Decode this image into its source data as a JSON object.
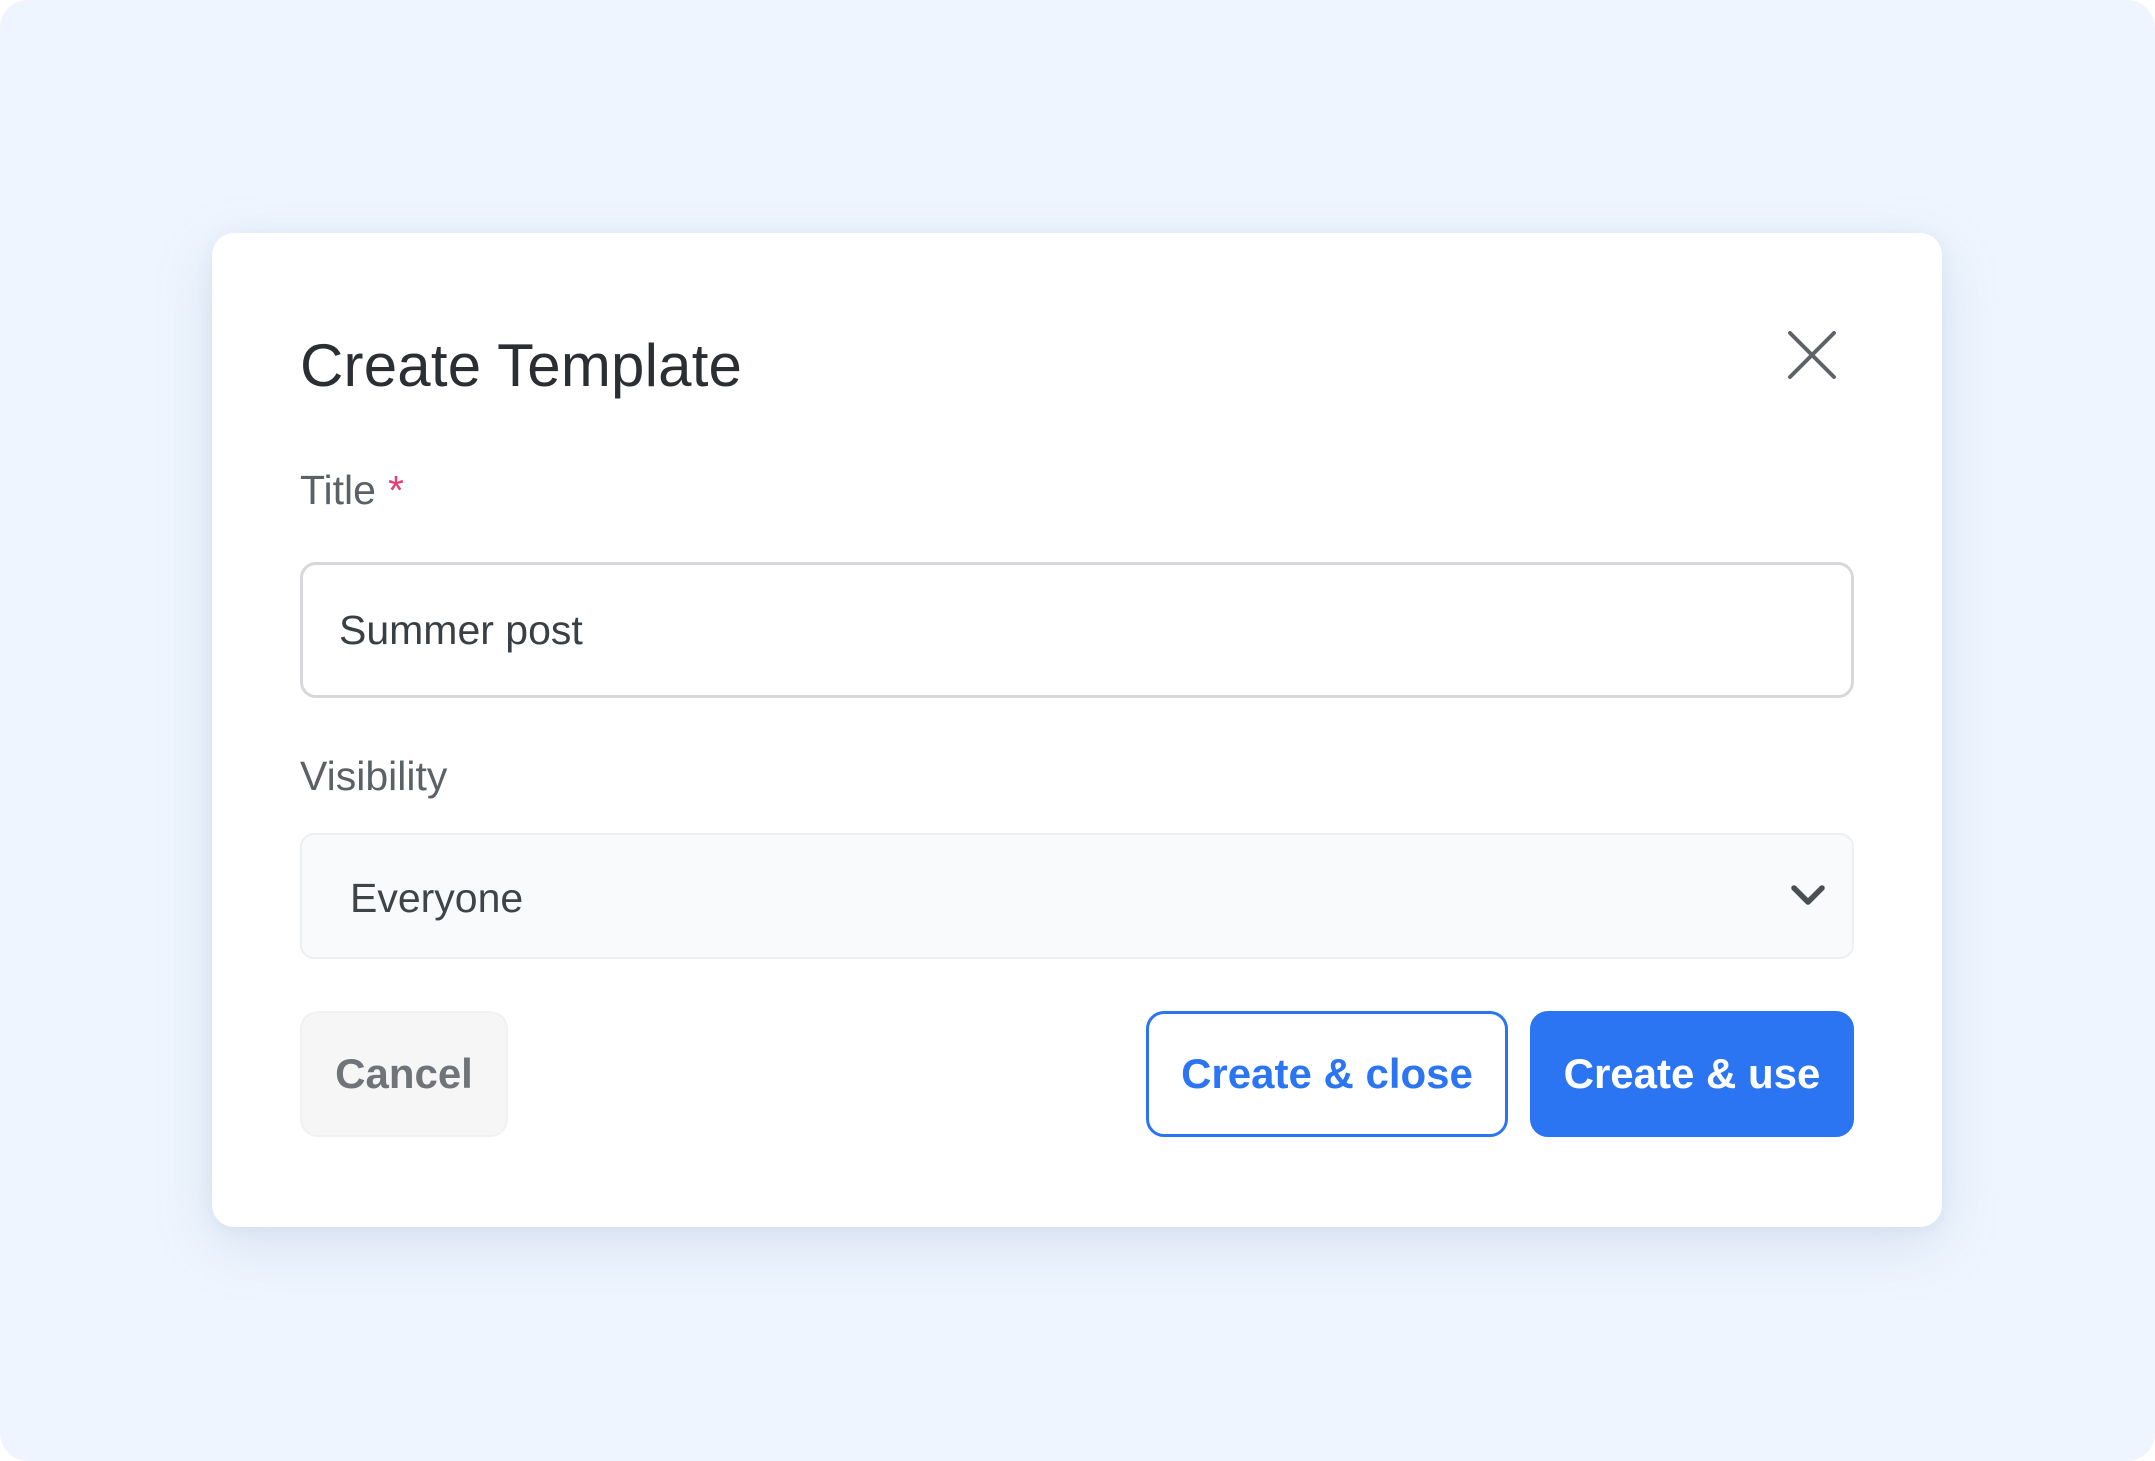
{
  "dialog": {
    "title": "Create Template",
    "close_icon": "close-icon"
  },
  "form": {
    "title_field": {
      "label": "Title",
      "required_marker": "*",
      "value": "Summer post"
    },
    "visibility_field": {
      "label": "Visibility",
      "selected": "Everyone",
      "dropdown_icon": "chevron-down-icon"
    }
  },
  "actions": {
    "cancel_label": "Cancel",
    "create_close_label": "Create & close",
    "create_use_label": "Create & use"
  },
  "colors": {
    "accent": "#2b74f2",
    "required": "#e53e78",
    "backdrop": "#eef5fe"
  }
}
